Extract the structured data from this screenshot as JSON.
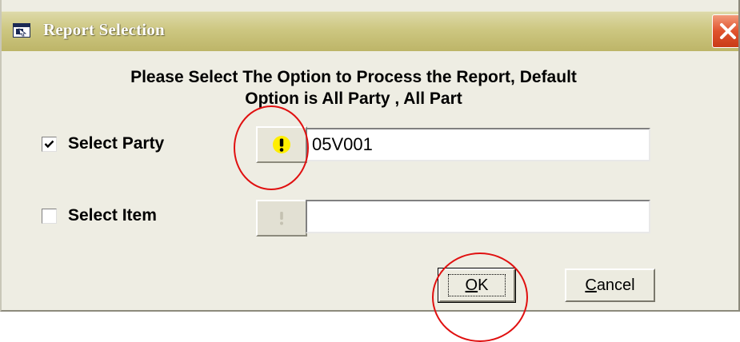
{
  "window": {
    "title": "Report Selection"
  },
  "heading": {
    "line1": "Please Select The Option to Process the Report, Default",
    "line2": "Option is All Party , All Part"
  },
  "party": {
    "label": "Select Party",
    "checked": true,
    "lookup_button_icon": "exclamation-icon",
    "value": "05V001"
  },
  "item": {
    "label": "Select Item",
    "checked": false,
    "lookup_button_icon": "exclamation-icon",
    "value": ""
  },
  "buttons": {
    "ok_mnemonic": "O",
    "ok_rest": "K",
    "cancel_mnemonic": "C",
    "cancel_rest": "ancel"
  },
  "colors": {
    "titlebar": "#cdc781",
    "close_button": "#e0532e",
    "annotation": "#e01010",
    "dialog_background": "#eeede3"
  }
}
